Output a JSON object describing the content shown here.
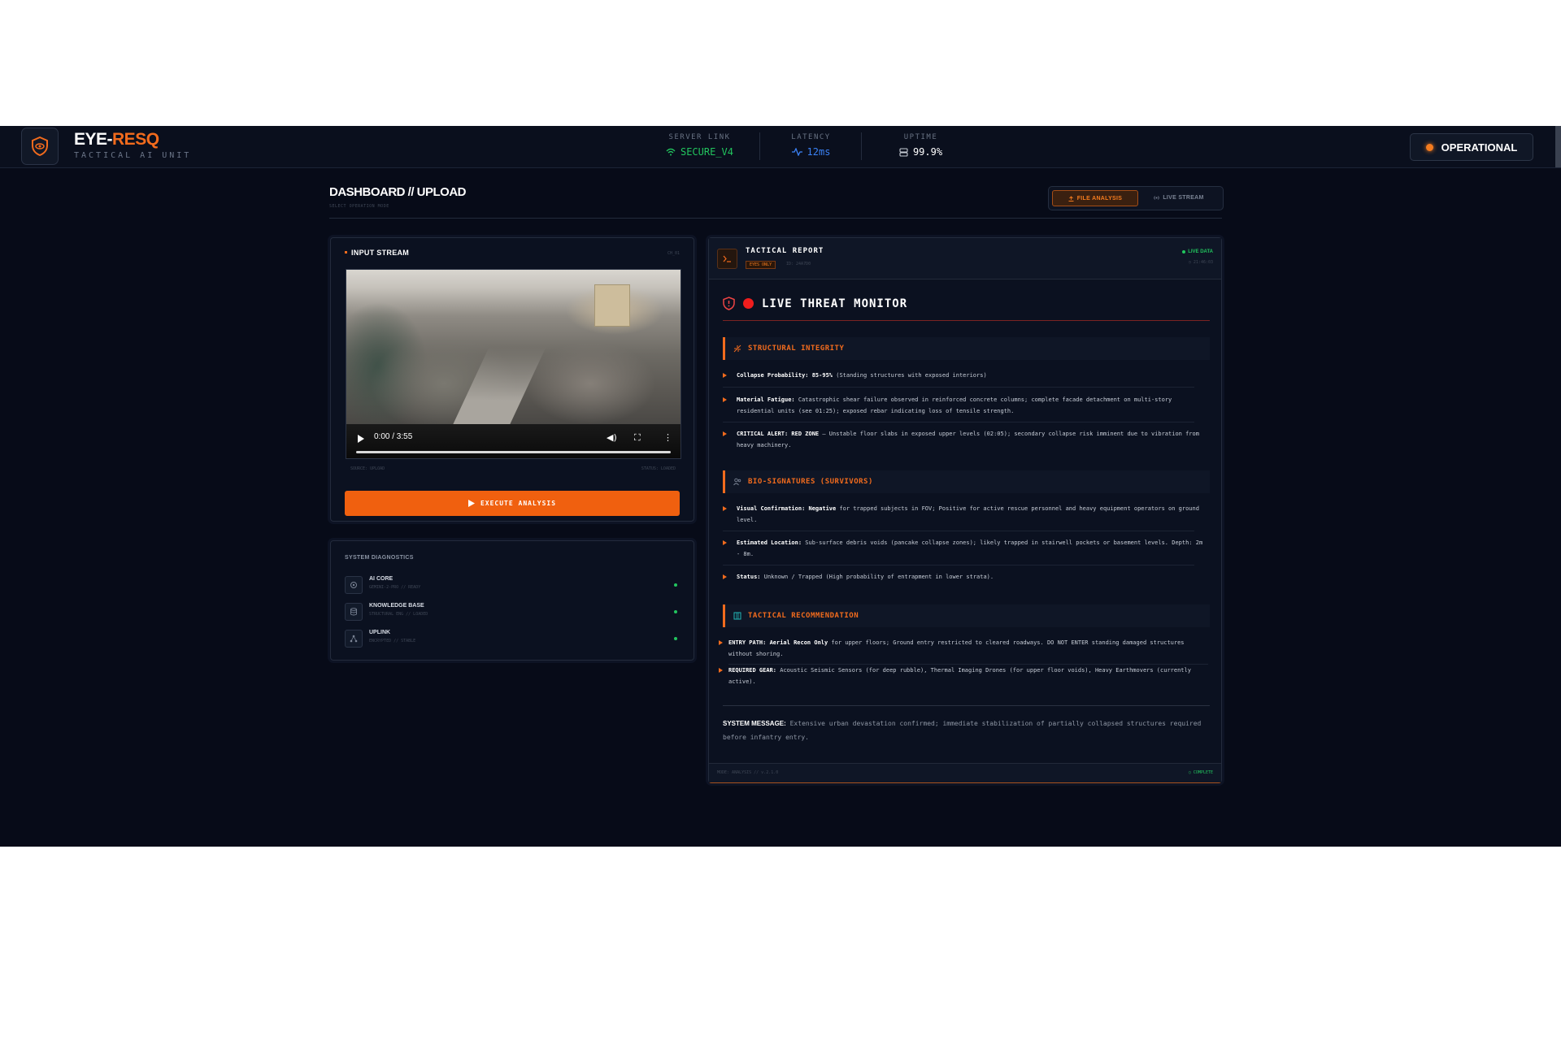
{
  "header": {
    "brand_first": "EYE-",
    "brand_second": "RESQ",
    "brand_sub": "TACTICAL AI UNIT",
    "stats": [
      {
        "label": "SERVER LINK",
        "value": "SECURE_V4",
        "color": "#22c55e",
        "icon": "wifi-icon"
      },
      {
        "label": "LATENCY",
        "value": "12ms",
        "color": "#3b82f6",
        "icon": "activity-icon"
      },
      {
        "label": "UPTIME",
        "value": "99.9%",
        "color": "#ffffff",
        "icon": "server-icon"
      }
    ],
    "status": "OPERATIONAL"
  },
  "page": {
    "title": "DASHBOARD // UPLOAD",
    "subtitle": "SELECT OPERATION MODE",
    "modes": {
      "file": "FILE ANALYSIS",
      "live": "LIVE STREAM"
    }
  },
  "input": {
    "title": "INPUT STREAM",
    "channel": "CH_01",
    "video_time": "0:00 / 3:55",
    "source": "SOURCE: UPLOAD",
    "status": "STATUS: LOADED",
    "execute_label": "EXECUTE ANALYSIS"
  },
  "diagnostics": {
    "title": "SYSTEM DIAGNOSTICS",
    "items": [
      {
        "name": "AI CORE",
        "sub": "GEMINI-2-PRO // READY"
      },
      {
        "name": "KNOWLEDGE BASE",
        "sub": "STRUCTURAL ENG // LOADED"
      },
      {
        "name": "UPLINK",
        "sub": "ENCRYPTED // STABLE"
      }
    ]
  },
  "report": {
    "title": "TACTICAL REPORT",
    "badge": "EYES ONLY",
    "id": "ID: 24A7D0",
    "live": "LIVE DATA",
    "time": "◷ 21:46:03",
    "monitor_title": "LIVE THREAT MONITOR",
    "sections": [
      {
        "title": "STRUCTURAL INTEGRITY",
        "items": [
          {
            "bold": "Collapse Probability: 85-95%",
            "text": " (Standing structures with exposed interiors)"
          },
          {
            "bold": "Material Fatigue:",
            "text": " Catastrophic shear failure observed in reinforced concrete columns; complete facade detachment on multi-story residential units (see 01:25); exposed rebar indicating loss of tensile strength."
          },
          {
            "bold": "CRITICAL ALERT: RED ZONE",
            "text": " — Unstable floor slabs in exposed upper levels (02:05); secondary collapse risk imminent due to vibration from heavy machinery."
          }
        ]
      },
      {
        "title": "BIO-SIGNATURES (SURVIVORS)",
        "items": [
          {
            "bold": "Visual Confirmation: Negative",
            "text": " for trapped subjects in FOV; Positive for active rescue personnel and heavy equipment operators on ground level."
          },
          {
            "bold": "Estimated Location:",
            "text": " Sub-surface debris voids (pancake collapse zones); likely trapped in stairwell pockets or basement levels. Depth: 2m - 8m."
          },
          {
            "bold": "Status:",
            "text": " Unknown / Trapped (High probability of entrapment in lower strata)."
          }
        ]
      },
      {
        "title": "TACTICAL RECOMMENDATION",
        "items": [
          {
            "bold": "ENTRY PATH: Aerial Recon Only",
            "text": " for upper floors; Ground entry restricted to cleared roadways. DO NOT ENTER standing damaged structures without shoring."
          },
          {
            "bold": "REQUIRED GEAR:",
            "text": " Acoustic Seismic Sensors (for deep rubble), Thermal Imaging Drones (for upper floor voids), Heavy Earthmovers (currently active)."
          }
        ]
      }
    ],
    "system_message_label": "SYSTEM MESSAGE:",
    "system_message": " Extensive urban devastation confirmed; immediate stabilization of partially collapsed structures required before infantry entry.",
    "footer_left": "MODE: ANALYSIS // v.2.1.0",
    "footer_right": "◯ COMPLETE"
  },
  "colors": {
    "accent": "#f26b1d",
    "ok": "#22c55e",
    "alert": "#ef1d1d"
  }
}
